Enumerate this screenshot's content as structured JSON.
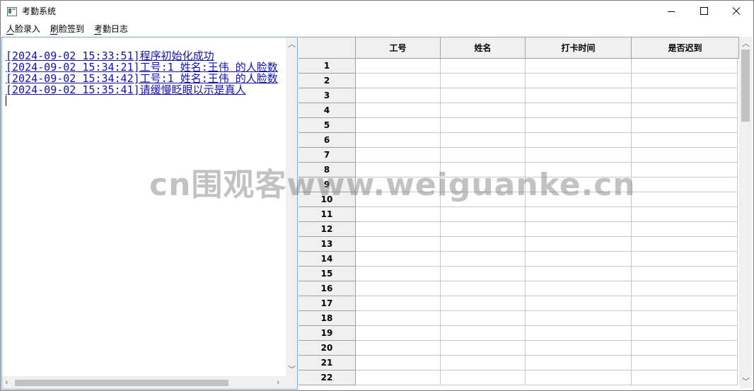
{
  "window": {
    "title": "考勤系统",
    "icon": "app-window-icon"
  },
  "menu": {
    "items": [
      {
        "label": "人脸录入",
        "accel_underline": true
      },
      {
        "label": "刷脸签到",
        "accel_underline": true
      },
      {
        "label": "考勤日志",
        "accel_underline": true
      }
    ]
  },
  "log": {
    "lines": [
      "[2024-09-02 15:33:51]程序初始化成功",
      "[2024-09-02 15:34:21]工号:1 姓名:王伟 的人脸数",
      "[2024-09-02 15:34:42]工号:1 姓名:王伟 的人脸数",
      "[2024-09-02 15:35:41]请缓慢眨眼以示是真人"
    ],
    "text_color": "#1010b0"
  },
  "grid": {
    "columns": [
      "工号",
      "姓名",
      "打卡时间",
      "是否迟到"
    ],
    "row_numbers": [
      "1",
      "2",
      "3",
      "4",
      "5",
      "6",
      "7",
      "8",
      "9",
      "10",
      "11",
      "12",
      "13",
      "14",
      "15",
      "16",
      "17",
      "18",
      "19",
      "20",
      "21",
      "22"
    ]
  },
  "watermark": "cn围观客www.weiguanke.cn"
}
